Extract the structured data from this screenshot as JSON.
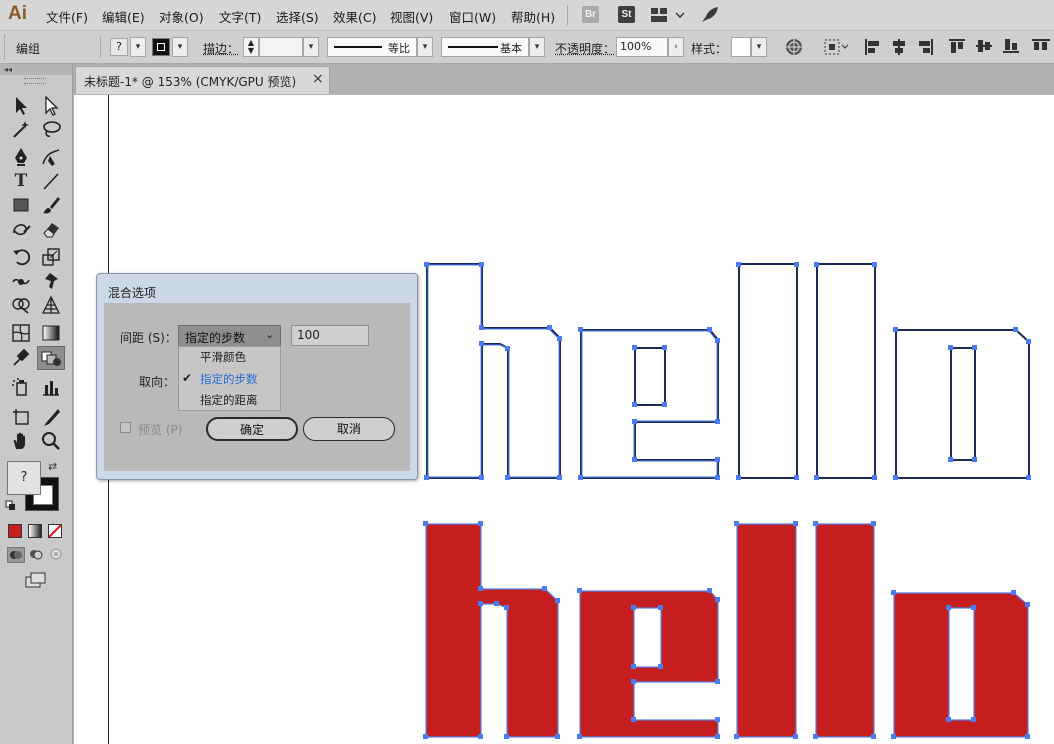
{
  "app": {
    "logo": "Ai"
  },
  "menu": [
    "文件(F)",
    "编辑(E)",
    "对象(O)",
    "文字(T)",
    "选择(S)",
    "效果(C)",
    "视图(V)",
    "窗口(W)",
    "帮助(H)"
  ],
  "menubar_icons": {
    "bridge": "Br",
    "stock": "St",
    "arrange": "workspace-icon",
    "rocket": "feedback-icon"
  },
  "controlbar": {
    "selection_label": "编组",
    "fill_value": "?",
    "stroke_label": "描边：",
    "stroke_profile": "等比",
    "brush": "基本",
    "opacity_label": "不透明度：",
    "opacity_value": "100%",
    "style_label": "样式："
  },
  "document_tab": {
    "title": "未标题-1* @ 153% (CMYK/GPU 预览)",
    "close": "×"
  },
  "toolbar": {
    "fill_stroke": "?"
  },
  "dialog": {
    "title": "混合选项",
    "spacing_label": "间距 (S)：",
    "spacing_selected": "指定的步数",
    "spacing_value": "100",
    "orientation_label": "取向：",
    "options": [
      "平滑颜色",
      "指定的步数",
      "指定的距离"
    ],
    "selected_index": 1,
    "preview_label": "预览 (P)",
    "ok_label": "确定",
    "cancel_label": "取消"
  },
  "colors": {
    "red_fill": "#c41e1e",
    "anchor_blue": "#4a7cf0",
    "outline_navy": "#1d2a5a",
    "accent": "#2a68d4"
  }
}
